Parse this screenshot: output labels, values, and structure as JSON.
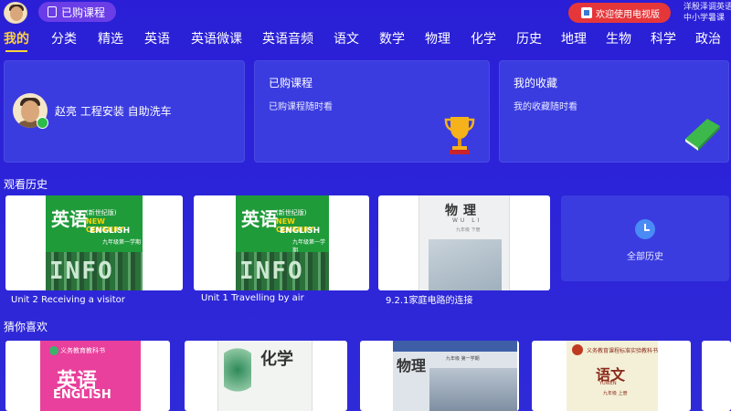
{
  "topbar": {
    "purchased_pill": "已购课程",
    "tv_pill": "欢迎使用电视版",
    "corner_line1": "洋殷泽调英语",
    "corner_line2": "中小学暑课"
  },
  "nav": {
    "items": [
      "我的",
      "分类",
      "精选",
      "英语",
      "英语微课",
      "英语音频",
      "语文",
      "数学",
      "物理",
      "化学",
      "历史",
      "地理",
      "生物",
      "科学",
      "政治"
    ],
    "active_index": 0
  },
  "user_card": {
    "name": "赵亮 工程安装 自助洗车"
  },
  "purchased_card": {
    "title": "已购课程",
    "subtitle": "已购课程随时看"
  },
  "favorites_card": {
    "title": "我的收藏",
    "subtitle": "我的收藏随时看"
  },
  "history": {
    "title": "观看历史",
    "items": [
      {
        "caption": "Unit 2 Receiving a visitor",
        "cover": {
          "title": "英语",
          "edition": "(新世纪版)",
          "line1": "NEW CENTURY",
          "line2": "ENGLISH",
          "grade": "九年级第一学期",
          "art": "INFO"
        }
      },
      {
        "caption": "Unit 1 Travelling by air",
        "cover": {
          "title": "英语",
          "edition": "(新世纪版)",
          "line1": "NEW CENTURY",
          "line2": "ENGLISH",
          "grade": "九年级第一学期",
          "art": "INFO"
        }
      },
      {
        "caption": "9.2.1家庭电路的连接",
        "cover": {
          "title": "物理",
          "pinyin": "WU LI",
          "grade": "九年级 下册"
        }
      }
    ],
    "all_label": "全部历史"
  },
  "recommend": {
    "title": "猜你喜欢",
    "items": [
      {
        "name": "english",
        "title": "英语",
        "sub": "ENGLISH",
        "top": "义务教育教科书"
      },
      {
        "name": "chemistry",
        "title": "化学"
      },
      {
        "name": "physics",
        "title": "物理",
        "top": "九年级 第一学期"
      },
      {
        "name": "chinese",
        "title": "语文",
        "top": "义务教育课程标准实验教科书",
        "pinyin": "YUWEN",
        "grade": "九年级 上册"
      }
    ]
  },
  "colors": {
    "background": "#2a1fd6",
    "card": "#3a3ce0",
    "active_nav": "#ffd43b",
    "tv_pill": "#e5373a",
    "purchased_pill": "#6b3de6"
  }
}
